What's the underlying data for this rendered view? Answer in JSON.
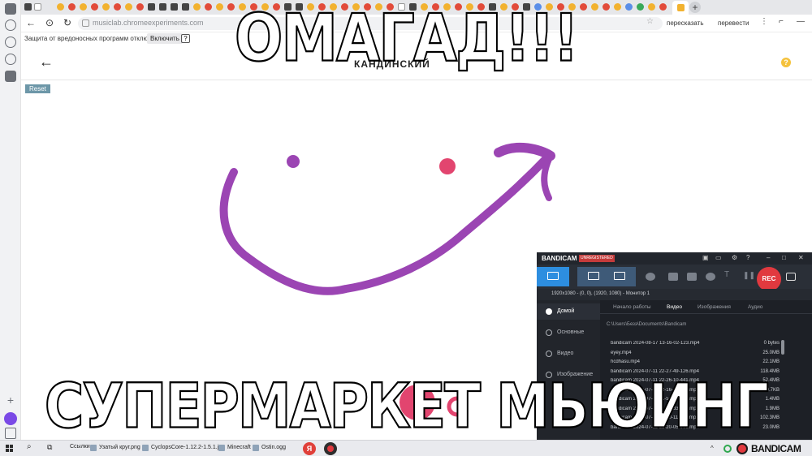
{
  "browser": {
    "url": "musiclab.chromeexperiments.com",
    "translate_label": "перевести",
    "translate_btn_label": "пересказать",
    "protection_text": "Защита от вредоносных программ отключена",
    "protection_button": "Включить",
    "protection_help": "?"
  },
  "page": {
    "back_icon": "←",
    "title": "КАНДИНСКИЙ",
    "help_icon": "?",
    "reset_label": "Reset"
  },
  "meme": {
    "top_caption": "ОМАГАД!!!",
    "bottom_caption": "СУПЕРМАРКЕТ МЬЮИНГ"
  },
  "bandicam": {
    "logo": "BANDICAM",
    "unregistered": "UNREGISTERED",
    "rec_label": "REC",
    "info": "1920x1080 - (0, 0), (1920, 1080) - Монитор 1",
    "nav": [
      "Домой",
      "Основные",
      "Видео",
      "Изображение"
    ],
    "tabs": [
      "Начало работы",
      "Видео",
      "Изображения",
      "Аудио"
    ],
    "path": "C:\\Users\\Безэ\\Documents\\Bandicam",
    "files": [
      {
        "name": "bandicam 2024-08-17 13-16-02-123.mp4",
        "size": "0 bytes"
      },
      {
        "name": "eyey.mp4",
        "size": "25.0MB"
      },
      {
        "name": "hcdhasu.mp4",
        "size": "22.1MB"
      },
      {
        "name": "bandicam 2024-07-11 22-27-49-126.mp4",
        "size": "118.4MB"
      },
      {
        "name": "bandicam 2024-07-11 22-26-10-441.mp4",
        "size": "52.4MB"
      },
      {
        "name": "bandicam 2024-07-11 22-16-16-315.mp4",
        "size": "430.7KB"
      },
      {
        "name": "bandicam 2024-07-11 21-56-40-109.mp4",
        "size": "1.4MB"
      },
      {
        "name": "bandicam 2024-07-11 21-50-33-000.mp4",
        "size": "1.9MB"
      },
      {
        "name": "bandicam 2024-07-11 21-30-11-979.mp4",
        "size": "102.3MB"
      },
      {
        "name": "bandicam 2024-07-11 21-20-05-551.mp4",
        "size": "23.0MB"
      }
    ]
  },
  "taskbar": {
    "search_icon": "search-icon",
    "links": "Ссылки",
    "items": [
      "Узатый круг.png",
      "CyclopsCore-1.12.2-1.5.1.jar",
      "Minecraft",
      "Ostin.ogg"
    ],
    "yandex": "Я",
    "tray_chevron": "^",
    "tray_brand": "BANDICAM"
  },
  "colors": {
    "stroke_purple": "#9b45b3",
    "eye_pink": "#e2456f",
    "accent_blue": "#2d8ee0",
    "rec_red": "#e1393f"
  }
}
